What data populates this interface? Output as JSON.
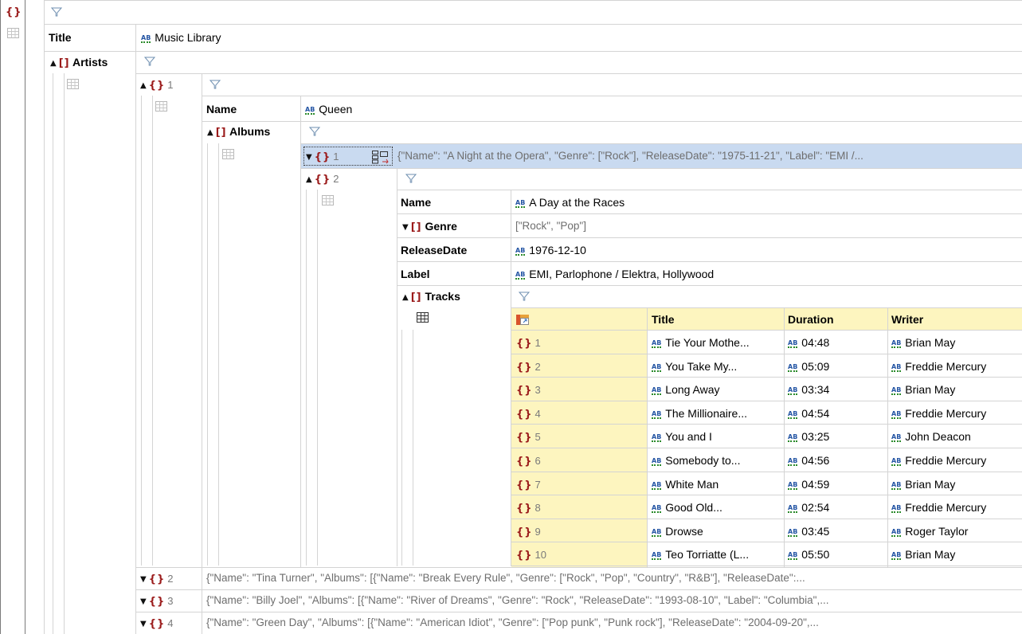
{
  "root": {
    "title_key": "Title",
    "title_value": "Music Library",
    "artists_key": "Artists"
  },
  "artist1": {
    "index": "1",
    "name_key": "Name",
    "name_value": "Queen",
    "albums_key": "Albums",
    "album1": {
      "index": "1",
      "collapsed_text": "{\"Name\": \"A Night at the Opera\", \"Genre\": [\"Rock\"], \"ReleaseDate\": \"1975-11-21\", \"Label\": \"EMI /..."
    },
    "album2": {
      "index": "2",
      "name_key": "Name",
      "name_value": "A Day at the Races",
      "genre_key": "Genre",
      "genre_value": "[\"Rock\", \"Pop\"]",
      "release_key": "ReleaseDate",
      "release_value": "1976-12-10",
      "label_key": "Label",
      "label_value": "EMI, Parlophone / Elektra, Hollywood",
      "tracks_key": "Tracks"
    }
  },
  "tracks": {
    "columns": [
      "Title",
      "Duration",
      "Writer"
    ],
    "rows": [
      {
        "index": "1",
        "title": "Tie Your Mothe...",
        "duration": "04:48",
        "writer": "Brian May"
      },
      {
        "index": "2",
        "title": "You Take My...",
        "duration": "05:09",
        "writer": "Freddie Mercury"
      },
      {
        "index": "3",
        "title": "Long Away",
        "duration": "03:34",
        "writer": "Brian May"
      },
      {
        "index": "4",
        "title": "The Millionaire...",
        "duration": "04:54",
        "writer": "Freddie Mercury"
      },
      {
        "index": "5",
        "title": "You and I",
        "duration": "03:25",
        "writer": "John Deacon"
      },
      {
        "index": "6",
        "title": "Somebody to...",
        "duration": "04:56",
        "writer": "Freddie Mercury"
      },
      {
        "index": "7",
        "title": "White Man",
        "duration": "04:59",
        "writer": "Brian May"
      },
      {
        "index": "8",
        "title": "Good Old...",
        "duration": "02:54",
        "writer": "Freddie Mercury"
      },
      {
        "index": "9",
        "title": "Drowse",
        "duration": "03:45",
        "writer": "Roger Taylor"
      },
      {
        "index": "10",
        "title": "Teo Torriatte (L...",
        "duration": "05:50",
        "writer": "Brian May"
      }
    ]
  },
  "other_artists": [
    {
      "index": "2",
      "text": "{\"Name\": \"Tina Turner\", \"Albums\": [{\"Name\": \"Break Every Rule\", \"Genre\": [\"Rock\", \"Pop\", \"Country\", \"R&B\"], \"ReleaseDate\":..."
    },
    {
      "index": "3",
      "text": "{\"Name\": \"Billy Joel\", \"Albums\": [{\"Name\": \"River of Dreams\", \"Genre\": \"Rock\", \"ReleaseDate\": \"1993-08-10\", \"Label\": \"Columbia\",..."
    },
    {
      "index": "4",
      "text": "{\"Name\": \"Green Day\", \"Albums\": [{\"Name\": \"American Idiot\", \"Genre\": [\"Pop punk\", \"Punk rock\"], \"ReleaseDate\": \"2004-09-20\",..."
    }
  ],
  "icons": {
    "object": "{}",
    "array": "[]",
    "string": "AB"
  },
  "colors": {
    "bracket": "#9b1b1b",
    "selection": "#c9daf0",
    "table_header": "#fdf5bf"
  }
}
